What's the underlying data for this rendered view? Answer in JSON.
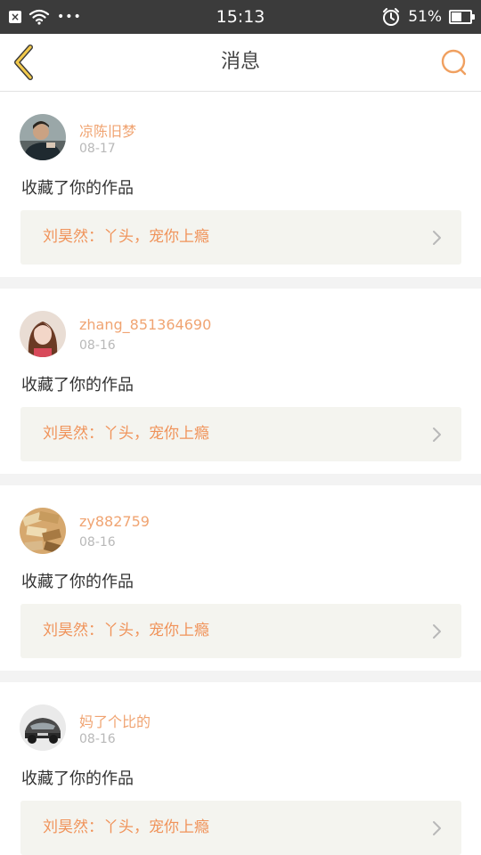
{
  "status_bar": {
    "time": "15:13",
    "battery_pct": "51%",
    "battery_level": 0.51,
    "dots": "•••"
  },
  "header": {
    "title": "消息",
    "back_icon": "chevron-left-icon",
    "search_icon": "search-icon",
    "accent_color": "#f0a060"
  },
  "notifications": [
    {
      "username": "凉陈旧梦",
      "date": "08-17",
      "action": "收藏了你的作品",
      "work": "刘昊然：丫头，宠你上瘾"
    },
    {
      "username": "zhang_851364690",
      "date": "08-16",
      "action": "收藏了你的作品",
      "work": "刘昊然：丫头，宠你上瘾"
    },
    {
      "username": "zy882759",
      "date": "08-16",
      "action": "收藏了你的作品",
      "work": "刘昊然：丫头，宠你上瘾"
    },
    {
      "username": "妈了个比的",
      "date": "08-16",
      "action": "收藏了你的作品",
      "work": "刘昊然：丫头，宠你上瘾"
    }
  ]
}
